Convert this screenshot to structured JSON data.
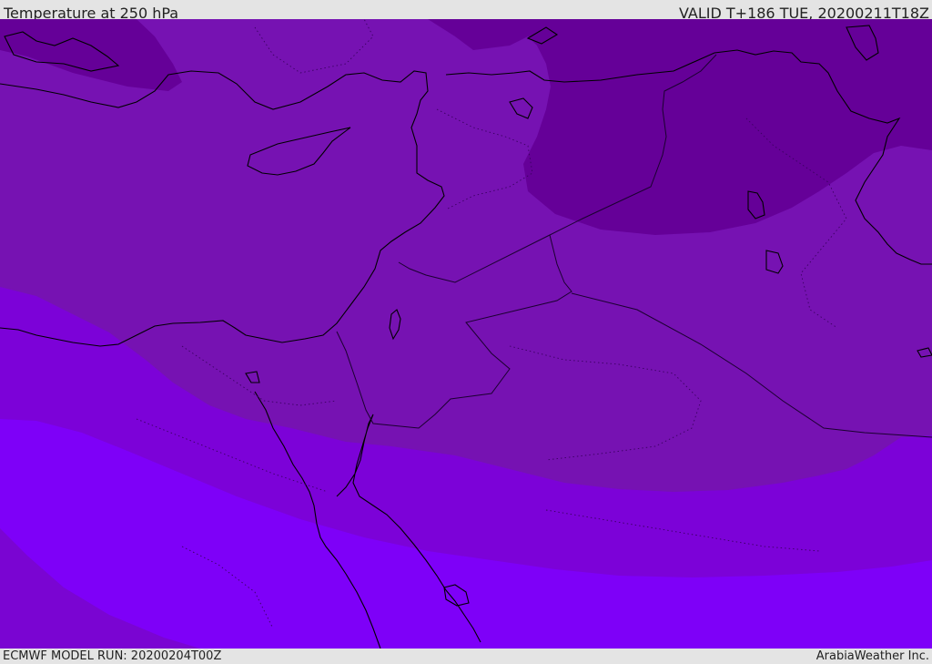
{
  "header": {
    "title": "Temperature at 250 hPa",
    "valid": "VALID T+186 TUE, 20200211T18Z"
  },
  "footer": {
    "model_run": "ECMWF MODEL RUN: 20200204T00Z",
    "credit": "ArabiaWeather Inc."
  },
  "map": {
    "colors": {
      "band_coldest": "#650098",
      "band_cold": "#7612b2",
      "band_mid": "#7c02d8",
      "band_warm": "#7e00f8",
      "band_southwest": "#7a05d2",
      "coastline": "#000000",
      "border": "#1b0030"
    }
  }
}
